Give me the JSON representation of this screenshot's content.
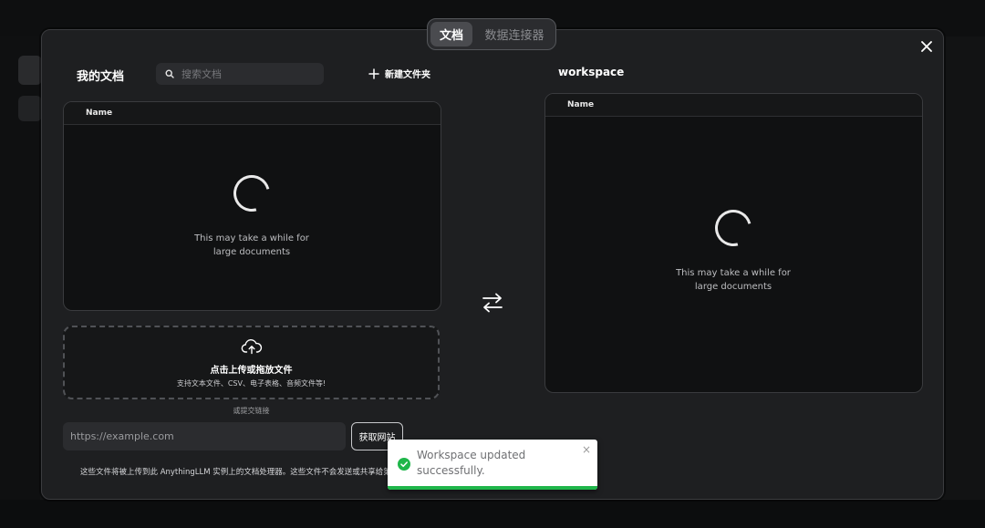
{
  "tabs": [
    {
      "label": "文档",
      "active": true
    },
    {
      "label": "数据连接器",
      "active": false
    }
  ],
  "left": {
    "title": "我的文档",
    "search_placeholder": "搜索文档",
    "new_folder_label": "新建文件夹",
    "column_name": "Name",
    "loading_line1": "This may take a while for",
    "loading_line2": "large documents"
  },
  "right": {
    "title": "workspace",
    "column_name": "Name",
    "loading_line1": "This may take a while for",
    "loading_line2": "large documents"
  },
  "upload": {
    "title": "点击上传或拖放文件",
    "subtitle": "支持文本文件、CSV、电子表格、音频文件等!",
    "or_link": "或提交链接",
    "url_placeholder": "https://example.com",
    "fetch_label": "获取网站",
    "footnote": "这些文件将被上传到此 AnythingLLM 实例上的文档处理器。这些文件不会发送或共享给第三方。"
  },
  "toast": {
    "message": "Workspace updated successfully.",
    "close": "×",
    "color": "#1fb64a"
  },
  "icons": {
    "close": "close-icon",
    "search": "search-icon",
    "plus": "plus-icon",
    "swap": "swap-arrows-icon",
    "upload": "cloud-upload-icon",
    "success": "check-circle-icon"
  }
}
